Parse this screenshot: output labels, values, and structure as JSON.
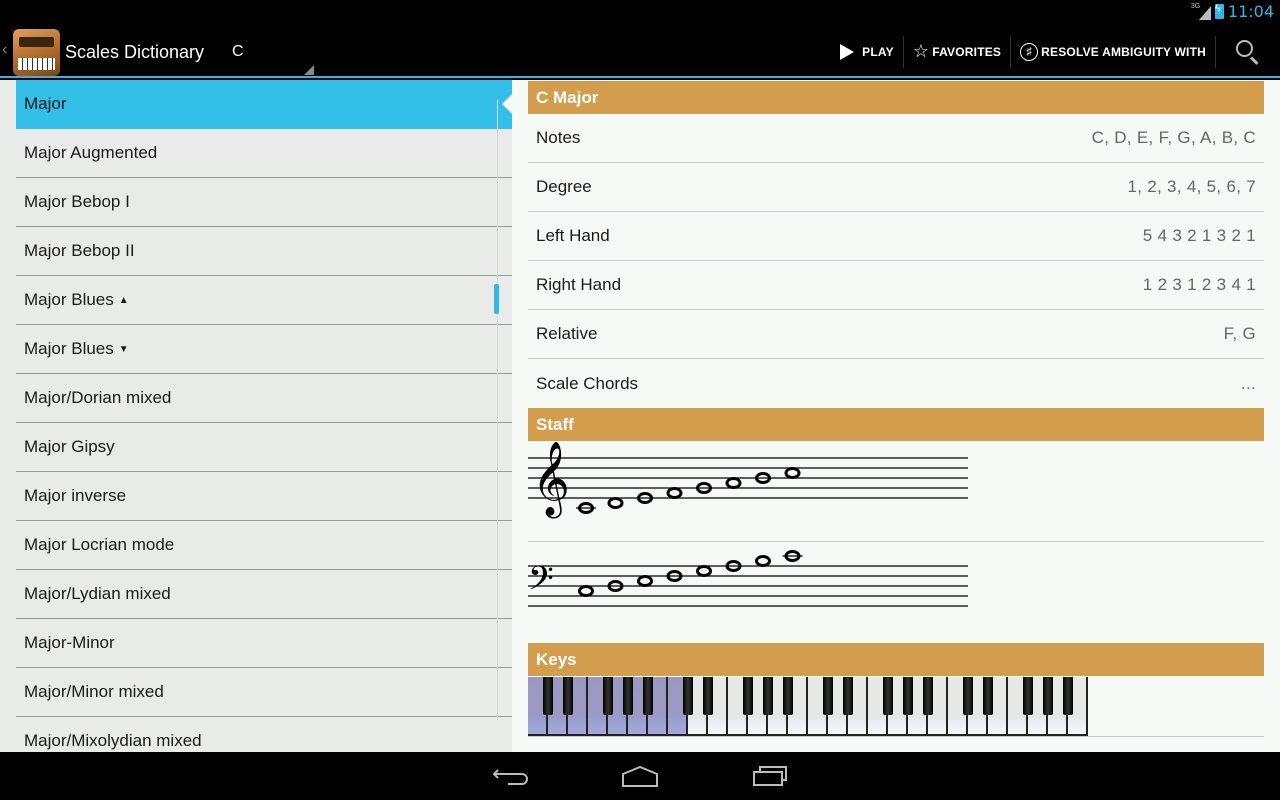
{
  "status_bar": {
    "network": "3G",
    "time": "11:04"
  },
  "action_bar": {
    "app_title": "Scales Dictionary",
    "root_note": "C",
    "actions": {
      "play": "PLAY",
      "favorites": "FAVORITES",
      "resolve": "RESOLVE AMBIGUITY WITH"
    }
  },
  "scale_list": {
    "selected_index": 0,
    "items": [
      {
        "label": "Major",
        "mark": ""
      },
      {
        "label": "Major Augmented",
        "mark": ""
      },
      {
        "label": "Major Bebop I",
        "mark": ""
      },
      {
        "label": "Major Bebop II",
        "mark": ""
      },
      {
        "label": "Major Blues",
        "mark": "▲"
      },
      {
        "label": "Major Blues",
        "mark": "▼"
      },
      {
        "label": "Major/Dorian mixed",
        "mark": ""
      },
      {
        "label": "Major Gipsy",
        "mark": ""
      },
      {
        "label": "Major inverse",
        "mark": ""
      },
      {
        "label": "Major Locrian mode",
        "mark": ""
      },
      {
        "label": "Major/Lydian mixed",
        "mark": ""
      },
      {
        "label": "Major-Minor",
        "mark": ""
      },
      {
        "label": "Major/Minor mixed",
        "mark": ""
      },
      {
        "label": "Major/Mixolydian mixed",
        "mark": ""
      }
    ]
  },
  "detail": {
    "title": "C Major",
    "rows": [
      {
        "label": "Notes",
        "value": "C, D, E, F, G, A, B, C"
      },
      {
        "label": "Degree",
        "value": "1, 2, 3, 4, 5, 6, 7"
      },
      {
        "label": "Left Hand",
        "value": "5 4 3 2 1 3 2 1"
      },
      {
        "label": "Right Hand",
        "value": "1 2 3 1 2 3 4 1"
      },
      {
        "label": "Relative",
        "value": "F, G"
      },
      {
        "label": "Scale Chords",
        "value": "..."
      }
    ],
    "staff_header": "Staff",
    "treble_notes": [
      "C4",
      "D4",
      "E4",
      "F4",
      "G4",
      "A4",
      "B4",
      "C5"
    ],
    "bass_notes": [
      "C3",
      "D3",
      "E3",
      "F3",
      "G3",
      "A3",
      "B3",
      "C4"
    ],
    "keys_header": "Keys",
    "keyboard": {
      "white_key_count": 28,
      "highlighted_white_keys": [
        0,
        1,
        2,
        3,
        4,
        5,
        6,
        7
      ],
      "highlight_color": "#9c9ac6"
    }
  },
  "colors": {
    "accent": "#33b5e5",
    "selection": "#33bfe8",
    "section_header": "#d29e4e"
  }
}
